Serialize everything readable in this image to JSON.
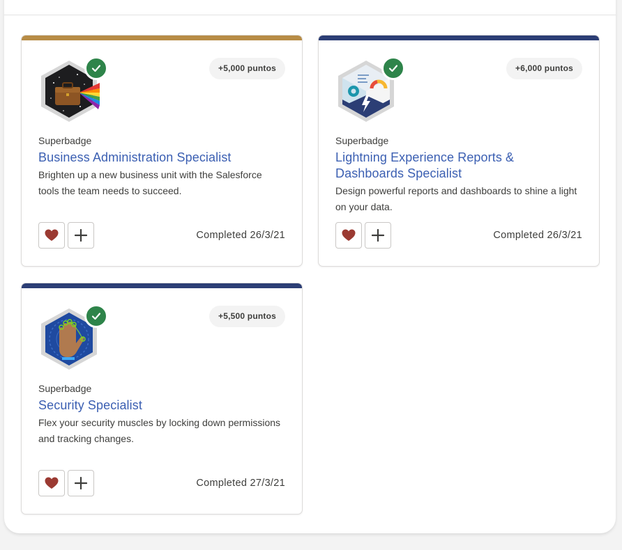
{
  "cards": [
    {
      "type_label": "Superbadge",
      "title": "Business Administration Specialist",
      "description": "Brighten up a new business unit with the Salesforce tools the team needs to succeed.",
      "points": "+5,000 puntos",
      "completed": "Completed 26/3/21",
      "accent_color": "#b78c46",
      "badge_icon": "briefcase-prism-badge-icon"
    },
    {
      "type_label": "Superbadge",
      "title": "Lightning Experience Reports & Dashboards Specialist",
      "description": "Design powerful reports and dashboards to shine a light on your data.",
      "points": "+6,000 puntos",
      "completed": "Completed 26/3/21",
      "accent_color": "#2c3e75",
      "badge_icon": "dashboard-lightning-badge-icon"
    },
    {
      "type_label": "Superbadge",
      "title": "Security Specialist",
      "description": "Flex your security muscles by locking down permissions and tracking changes.",
      "points": "+5,500 puntos",
      "completed": "Completed 27/3/21",
      "accent_color": "#2c3e75",
      "badge_icon": "hand-scan-badge-icon"
    }
  ],
  "icons": {
    "completed_check": "check-icon",
    "favorite": "heart-icon",
    "add": "plus-icon"
  },
  "colors": {
    "title_link": "#3b5fb2",
    "check_green": "#2e844a",
    "heart_red": "#9b3a32"
  }
}
